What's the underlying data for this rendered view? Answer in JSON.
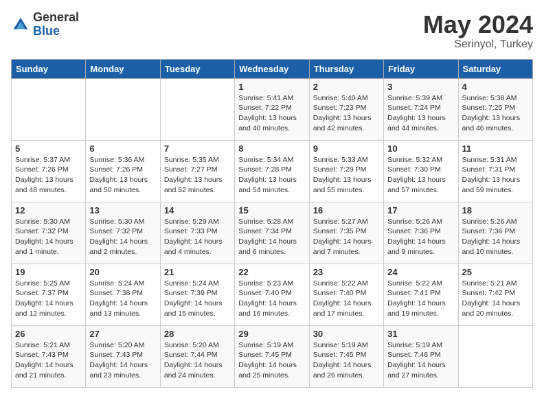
{
  "header": {
    "logo_general": "General",
    "logo_blue": "Blue",
    "title": "May 2024",
    "location": "Serinyol, Turkey"
  },
  "days_of_week": [
    "Sunday",
    "Monday",
    "Tuesday",
    "Wednesday",
    "Thursday",
    "Friday",
    "Saturday"
  ],
  "weeks": [
    [
      {
        "day": "",
        "info": ""
      },
      {
        "day": "",
        "info": ""
      },
      {
        "day": "",
        "info": ""
      },
      {
        "day": "1",
        "info": "Sunrise: 5:41 AM\nSunset: 7:22 PM\nDaylight: 13 hours\nand 40 minutes."
      },
      {
        "day": "2",
        "info": "Sunrise: 5:40 AM\nSunset: 7:23 PM\nDaylight: 13 hours\nand 42 minutes."
      },
      {
        "day": "3",
        "info": "Sunrise: 5:39 AM\nSunset: 7:24 PM\nDaylight: 13 hours\nand 44 minutes."
      },
      {
        "day": "4",
        "info": "Sunrise: 5:38 AM\nSunset: 7:25 PM\nDaylight: 13 hours\nand 46 minutes."
      }
    ],
    [
      {
        "day": "5",
        "info": "Sunrise: 5:37 AM\nSunset: 7:26 PM\nDaylight: 13 hours\nand 48 minutes."
      },
      {
        "day": "6",
        "info": "Sunrise: 5:36 AM\nSunset: 7:26 PM\nDaylight: 13 hours\nand 50 minutes."
      },
      {
        "day": "7",
        "info": "Sunrise: 5:35 AM\nSunset: 7:27 PM\nDaylight: 13 hours\nand 52 minutes."
      },
      {
        "day": "8",
        "info": "Sunrise: 5:34 AM\nSunset: 7:28 PM\nDaylight: 13 hours\nand 54 minutes."
      },
      {
        "day": "9",
        "info": "Sunrise: 5:33 AM\nSunset: 7:29 PM\nDaylight: 13 hours\nand 55 minutes."
      },
      {
        "day": "10",
        "info": "Sunrise: 5:32 AM\nSunset: 7:30 PM\nDaylight: 13 hours\nand 57 minutes."
      },
      {
        "day": "11",
        "info": "Sunrise: 5:31 AM\nSunset: 7:31 PM\nDaylight: 13 hours\nand 59 minutes."
      }
    ],
    [
      {
        "day": "12",
        "info": "Sunrise: 5:30 AM\nSunset: 7:32 PM\nDaylight: 14 hours\nand 1 minute."
      },
      {
        "day": "13",
        "info": "Sunrise: 5:30 AM\nSunset: 7:32 PM\nDaylight: 14 hours\nand 2 minutes."
      },
      {
        "day": "14",
        "info": "Sunrise: 5:29 AM\nSunset: 7:33 PM\nDaylight: 14 hours\nand 4 minutes."
      },
      {
        "day": "15",
        "info": "Sunrise: 5:28 AM\nSunset: 7:34 PM\nDaylight: 14 hours\nand 6 minutes."
      },
      {
        "day": "16",
        "info": "Sunrise: 5:27 AM\nSunset: 7:35 PM\nDaylight: 14 hours\nand 7 minutes."
      },
      {
        "day": "17",
        "info": "Sunrise: 5:26 AM\nSunset: 7:36 PM\nDaylight: 14 hours\nand 9 minutes."
      },
      {
        "day": "18",
        "info": "Sunrise: 5:26 AM\nSunset: 7:36 PM\nDaylight: 14 hours\nand 10 minutes."
      }
    ],
    [
      {
        "day": "19",
        "info": "Sunrise: 5:25 AM\nSunset: 7:37 PM\nDaylight: 14 hours\nand 12 minutes."
      },
      {
        "day": "20",
        "info": "Sunrise: 5:24 AM\nSunset: 7:38 PM\nDaylight: 14 hours\nand 13 minutes."
      },
      {
        "day": "21",
        "info": "Sunrise: 5:24 AM\nSunset: 7:39 PM\nDaylight: 14 hours\nand 15 minutes."
      },
      {
        "day": "22",
        "info": "Sunrise: 5:23 AM\nSunset: 7:40 PM\nDaylight: 14 hours\nand 16 minutes."
      },
      {
        "day": "23",
        "info": "Sunrise: 5:22 AM\nSunset: 7:40 PM\nDaylight: 14 hours\nand 17 minutes."
      },
      {
        "day": "24",
        "info": "Sunrise: 5:22 AM\nSunset: 7:41 PM\nDaylight: 14 hours\nand 19 minutes."
      },
      {
        "day": "25",
        "info": "Sunrise: 5:21 AM\nSunset: 7:42 PM\nDaylight: 14 hours\nand 20 minutes."
      }
    ],
    [
      {
        "day": "26",
        "info": "Sunrise: 5:21 AM\nSunset: 7:43 PM\nDaylight: 14 hours\nand 21 minutes."
      },
      {
        "day": "27",
        "info": "Sunrise: 5:20 AM\nSunset: 7:43 PM\nDaylight: 14 hours\nand 23 minutes."
      },
      {
        "day": "28",
        "info": "Sunrise: 5:20 AM\nSunset: 7:44 PM\nDaylight: 14 hours\nand 24 minutes."
      },
      {
        "day": "29",
        "info": "Sunrise: 5:19 AM\nSunset: 7:45 PM\nDaylight: 14 hours\nand 25 minutes."
      },
      {
        "day": "30",
        "info": "Sunrise: 5:19 AM\nSunset: 7:45 PM\nDaylight: 14 hours\nand 26 minutes."
      },
      {
        "day": "31",
        "info": "Sunrise: 5:19 AM\nSunset: 7:46 PM\nDaylight: 14 hours\nand 27 minutes."
      },
      {
        "day": "",
        "info": ""
      }
    ]
  ]
}
